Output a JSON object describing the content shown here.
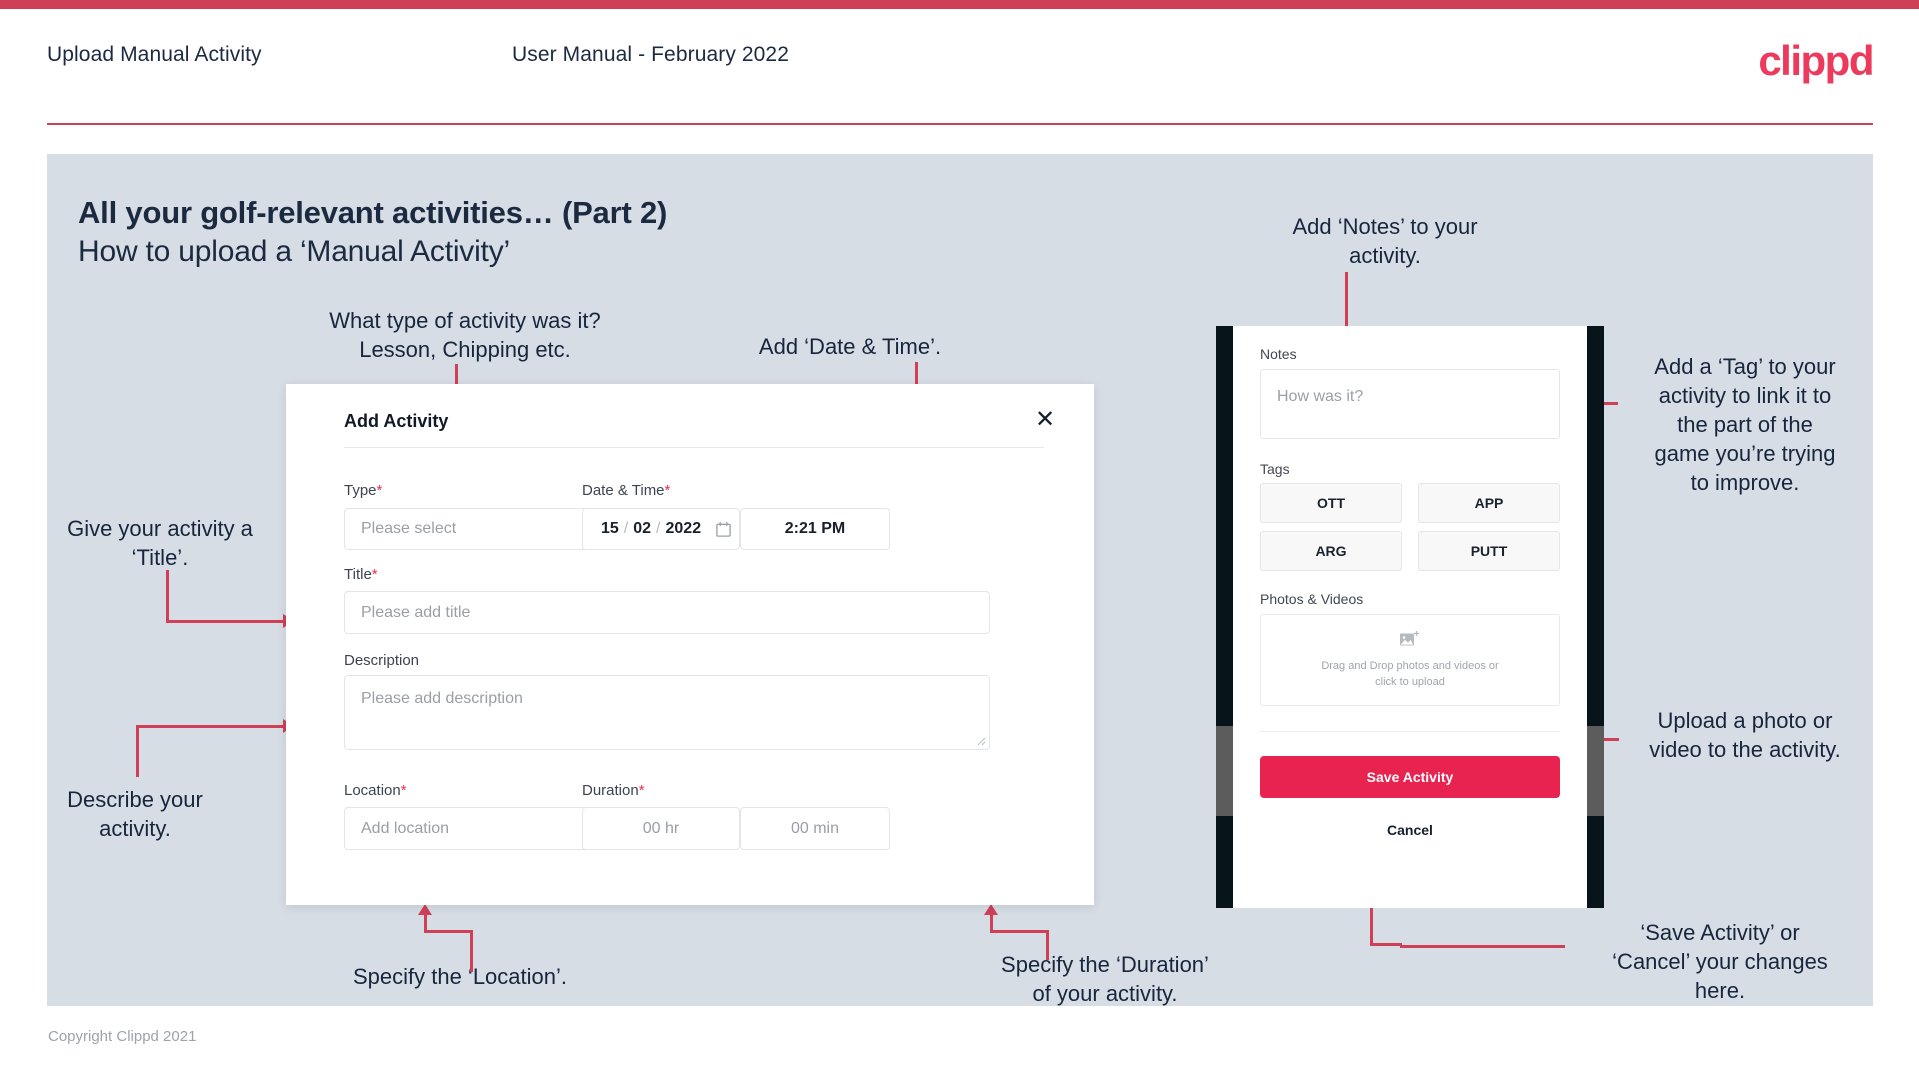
{
  "header": {
    "title": "Upload Manual Activity",
    "subtitle": "User Manual - February 2022",
    "logo": "clippd"
  },
  "slide": {
    "title": "All your golf-relevant activities… (Part 2)",
    "subtitle": "How to upload a ‘Manual Activity’"
  },
  "annotations": {
    "type": "What type of activity was it?\nLesson, Chipping etc.",
    "datetime": "Add ‘Date & Time’.",
    "title": "Give your activity a\n‘Title’.",
    "description": "Describe your\nactivity.",
    "location": "Specify the ‘Location’.",
    "duration": "Specify the ‘Duration’\nof your activity.",
    "notes": "Add ‘Notes’ to your\nactivity.",
    "tags": "Add a ‘Tag’ to your\nactivity to link it to\nthe part of the\ngame you’re trying\nto improve.",
    "photos": "Upload a photo or\nvideo to the activity.",
    "save": "‘Save Activity’ or\n‘Cancel’ your changes\nhere."
  },
  "dialog": {
    "title": "Add Activity",
    "close_icon": "close-icon",
    "fields": {
      "type": {
        "label": "Type",
        "required": "*",
        "placeholder": "Please select"
      },
      "datetime": {
        "label": "Date & Time",
        "required": "*",
        "day": "15",
        "sep1": "/",
        "month": "02",
        "sep2": "/",
        "year": "2022",
        "time": "2:21 PM"
      },
      "title": {
        "label": "Title",
        "required": "*",
        "placeholder": "Please add title"
      },
      "description": {
        "label": "Description",
        "placeholder": "Please add description"
      },
      "location": {
        "label": "Location",
        "required": "*",
        "placeholder": "Add location"
      },
      "duration": {
        "label": "Duration",
        "required": "*",
        "hours": "00 hr",
        "minutes": "00 min"
      }
    }
  },
  "phone": {
    "notes": {
      "label": "Notes",
      "placeholder": "How was it?"
    },
    "tags": {
      "label": "Tags",
      "items": [
        "OTT",
        "APP",
        "ARG",
        "PUTT"
      ]
    },
    "photos": {
      "label": "Photos & Videos",
      "dropzone_line1": "Drag and Drop photos and videos or",
      "dropzone_line2": "click to upload",
      "icon": "add-image-icon"
    },
    "save_label": "Save Activity",
    "cancel_label": "Cancel"
  },
  "footer": {
    "copyright": "Copyright Clippd 2021"
  },
  "colors": {
    "brand_pink": "#ec3a5d",
    "accent_red": "#cf4057",
    "save_button": "#e8234f",
    "slide_bg": "#d7dde5",
    "text_dark": "#17263c"
  }
}
